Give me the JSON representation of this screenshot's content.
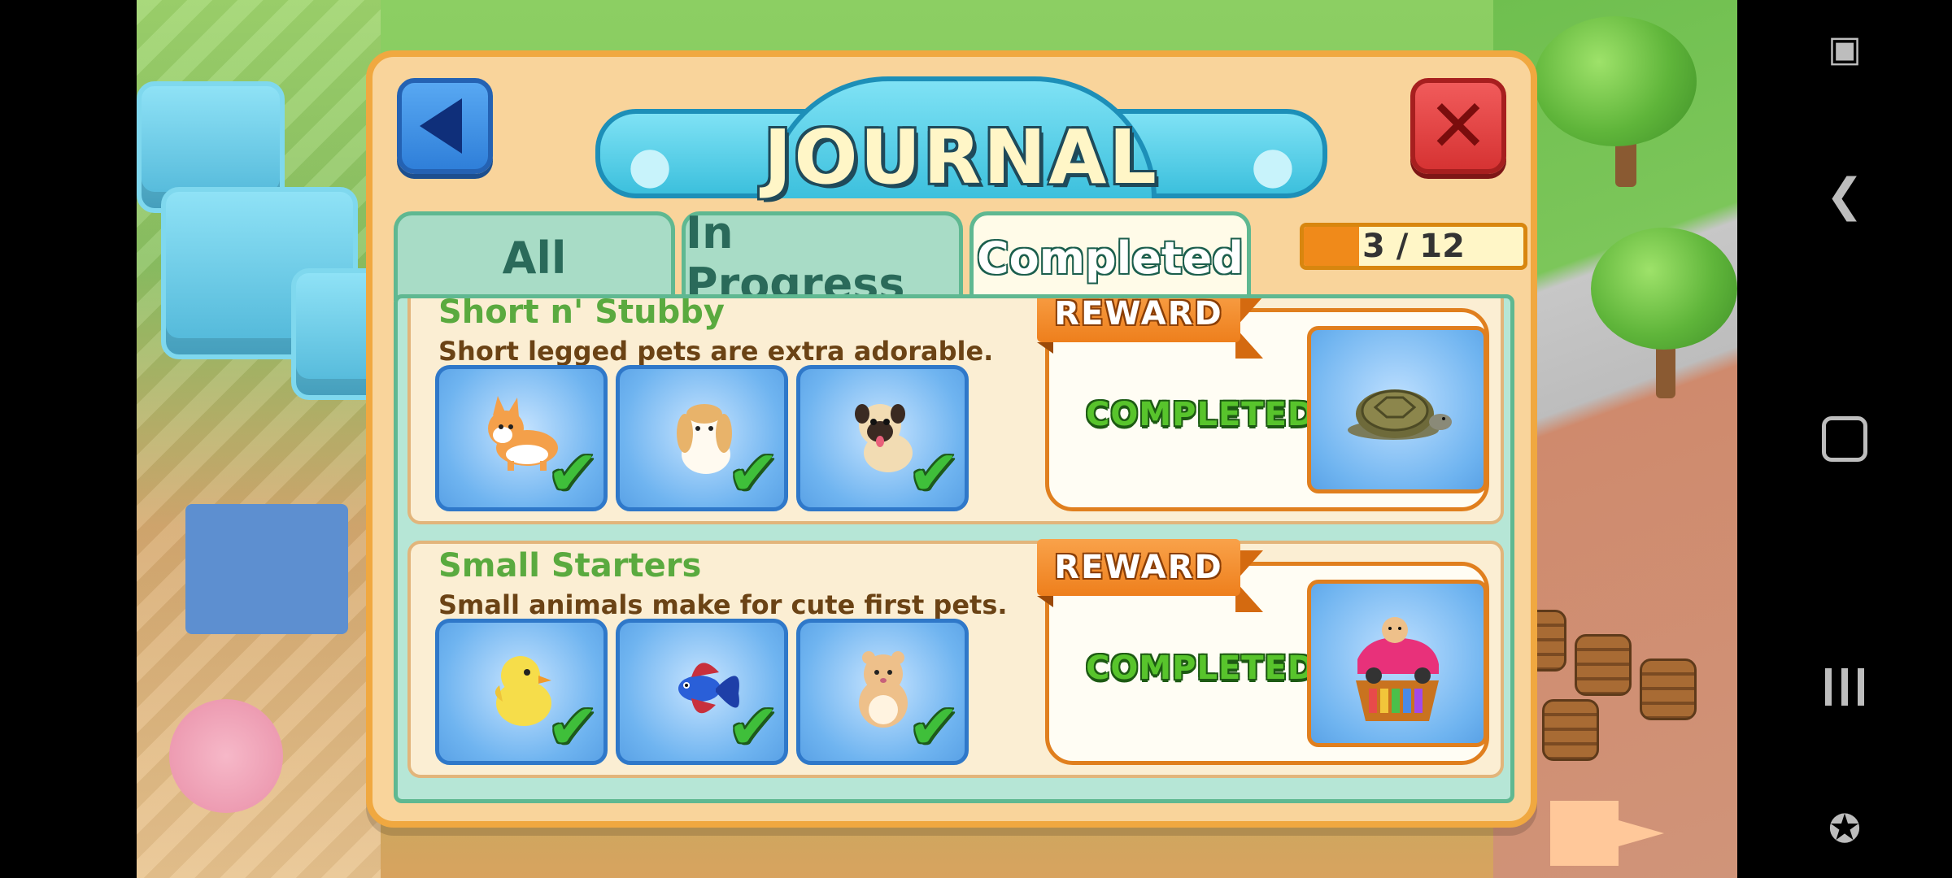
{
  "dialog": {
    "title": "JOURNAL",
    "tabs": [
      {
        "label": "All",
        "active": false
      },
      {
        "label": "In Progress",
        "active": false
      },
      {
        "label": "Completed",
        "active": true
      }
    ],
    "progress": {
      "text": "3 / 12",
      "fraction": 0.25
    }
  },
  "entries": [
    {
      "name": "Short n' Stubby",
      "description": "Short legged pets are extra adorable.",
      "pets": [
        "corgi-icon",
        "lop-bunny-icon",
        "pug-icon"
      ],
      "reward_label": "REWARD",
      "status": "COMPLETED",
      "reward_icon": "tortoise-icon"
    },
    {
      "name": "Small Starters",
      "description": "Small animals make for cute first pets.",
      "pets": [
        "chick-icon",
        "betta-fish-icon",
        "hamster-icon"
      ],
      "reward_label": "REWARD",
      "status": "COMPLETED",
      "reward_icon": "hamster-car-toy-icon"
    }
  ],
  "colors": {
    "panel": "#f9d49b",
    "panel_border": "#f0a840",
    "tab_inactive": "#a8dcc6",
    "tab_active": "#fffbe8",
    "pet_slot": "#6fb4f0",
    "reward_ribbon": "#ee7f1c",
    "completed_green": "#58c42c"
  }
}
